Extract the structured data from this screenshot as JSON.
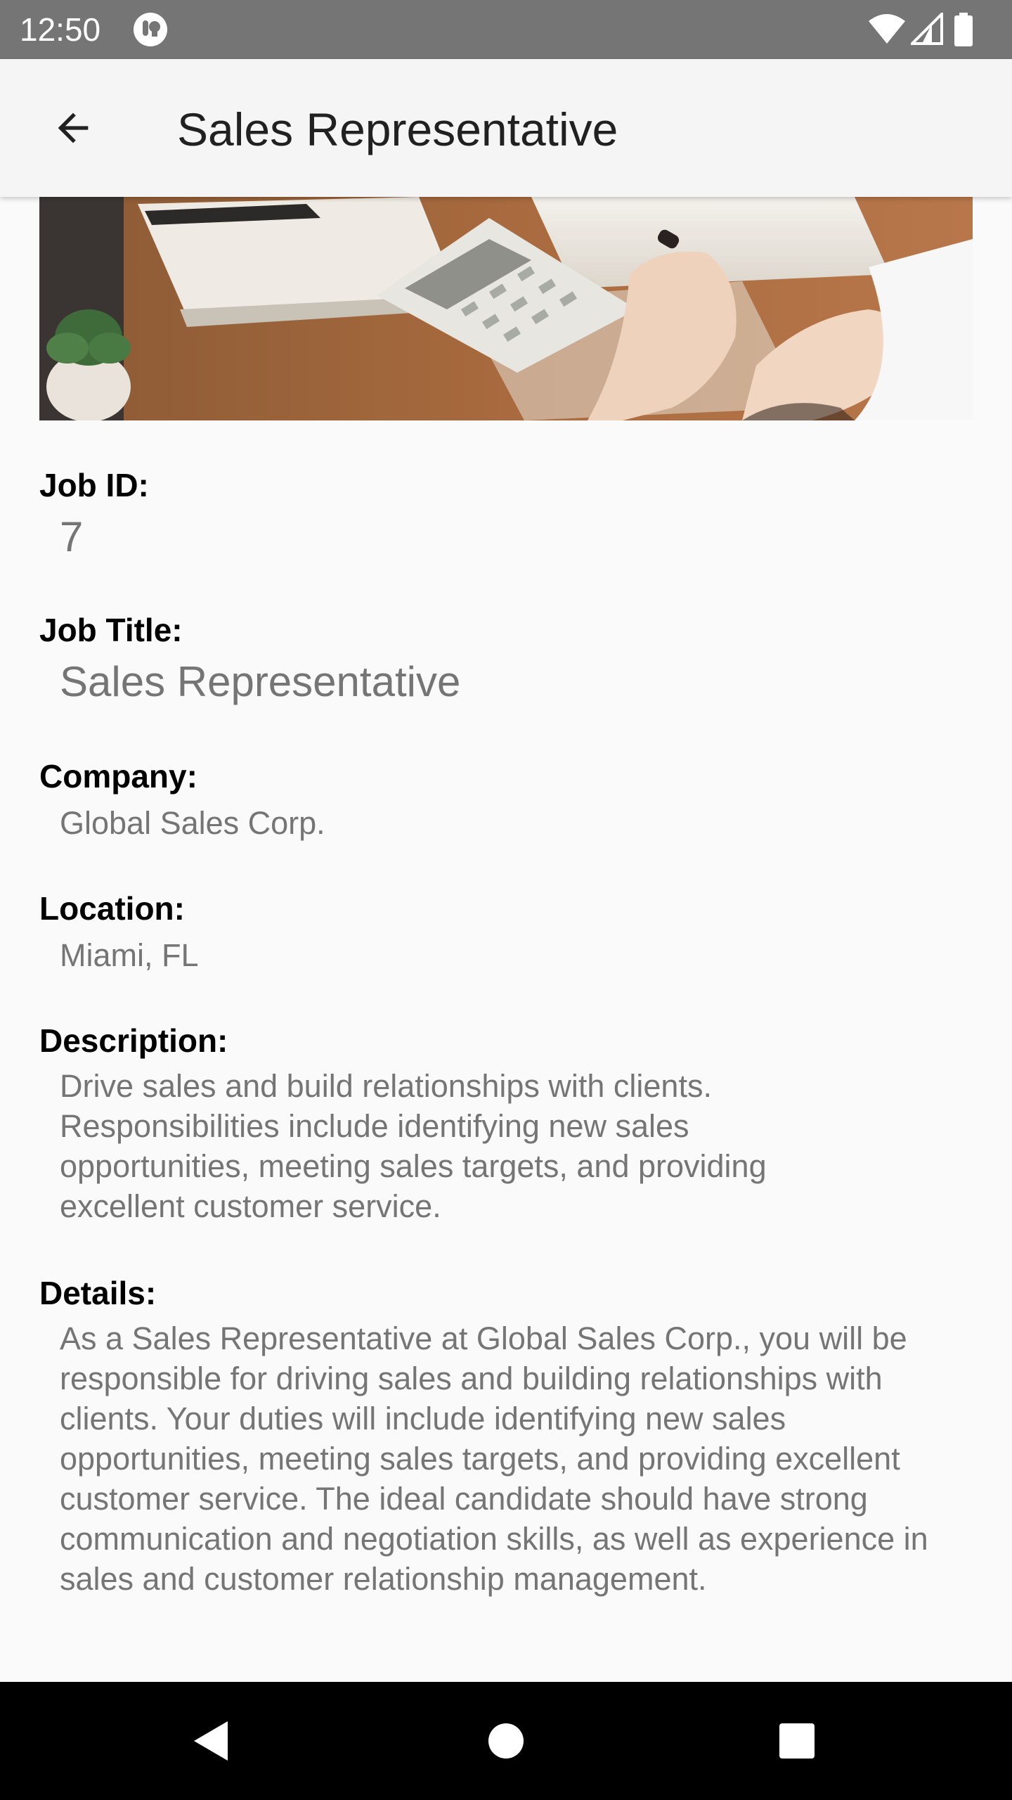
{
  "status_bar": {
    "time": "12:50"
  },
  "app_bar": {
    "title": "Sales Representative"
  },
  "job": {
    "id_label": "Job ID:",
    "id_value": "7",
    "title_label": "Job Title:",
    "title_value": "Sales Representative",
    "company_label": "Company:",
    "company_value": "Global Sales Corp.",
    "location_label": "Location:",
    "location_value": "Miami, FL",
    "description_label": "Description:",
    "description_value": "Drive sales and build relationships with clients. Responsibilities include identifying new sales opportunities, meeting sales targets, and providing excellent customer service.",
    "details_label": "Details:",
    "details_value": "As a Sales Representative at Global Sales Corp., you will be responsible for driving sales and building relationships with clients. Your duties will include identifying new sales opportunities, meeting sales targets, and providing excellent customer service. The ideal candidate should have strong communication and negotiation skills, as well as experience in sales and customer relationship management."
  },
  "icons": {
    "back": "arrow-back-icon",
    "wifi": "wifi-icon",
    "signal": "cell-signal-icon",
    "battery": "battery-icon",
    "nav_back": "nav-back-icon",
    "nav_home": "nav-home-icon",
    "nav_recents": "nav-recents-icon"
  },
  "colors": {
    "status_bar": "#757575",
    "app_bar": "#f5f5f5",
    "background": "#fafafa",
    "label_text": "#000000",
    "value_text": "#757575",
    "nav_bar": "#000000"
  }
}
